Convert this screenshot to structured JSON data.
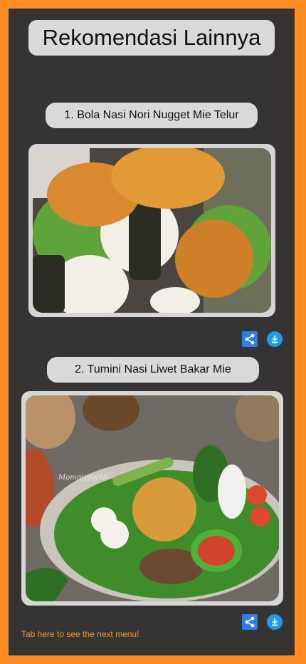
{
  "page": {
    "title": "Rekomendasi Lainnya"
  },
  "menus": [
    {
      "label": "1. Bola Nasi Nori Nugget Mie Telur"
    },
    {
      "label": "2. Tumini Nasi Liwet Bakar Mie"
    }
  ],
  "icons": {
    "share": "share-icon",
    "download": "download-icon"
  },
  "footer": {
    "hint": "Tab here to see the next menu!"
  },
  "image2_watermark": "MommyJoy88",
  "colors": {
    "accent": "#ff8c24",
    "background": "#353433",
    "pill": "#d9d9d9",
    "share": "#2f7de6",
    "download": "#1e9be9",
    "hint": "#f39a2a"
  }
}
